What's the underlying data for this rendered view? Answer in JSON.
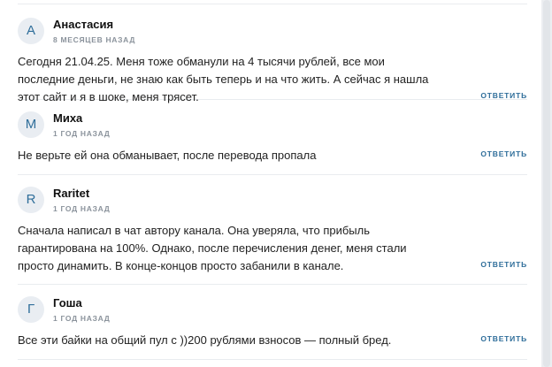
{
  "comments": [
    {
      "initial": "А",
      "author": "Анастасия",
      "time": "8 месяцев назад",
      "text": "Сегодня 21.04.25. Меня тоже обманули на 4 тысячи рублей, все мои последние деньги, не знаю как быть теперь и на что жить. А сейчас я нашла этот сайт и я в шоке, меня трясет.",
      "reply_label": "ответить"
    },
    {
      "initial": "М",
      "author": "Миха",
      "time": "1 год назад",
      "text": "Не верьте ей она обманывает, после перевода пропала",
      "reply_label": "ответить"
    },
    {
      "initial": "R",
      "author": "Raritet",
      "time": "1 год назад",
      "text": "Сначала написал в чат автору канала. Она уверяла, что прибыль гарантирована на 100%. Однако, после перечисления денег, меня стали просто динамить. В конце-концов просто забанили в канале.",
      "reply_label": "ответить"
    },
    {
      "initial": "Г",
      "author": "Гоша",
      "time": "1 год назад",
      "text": "Все эти байки на общий пул с ))200 рублями взносов — полный бред.",
      "reply_label": "ответить"
    }
  ]
}
